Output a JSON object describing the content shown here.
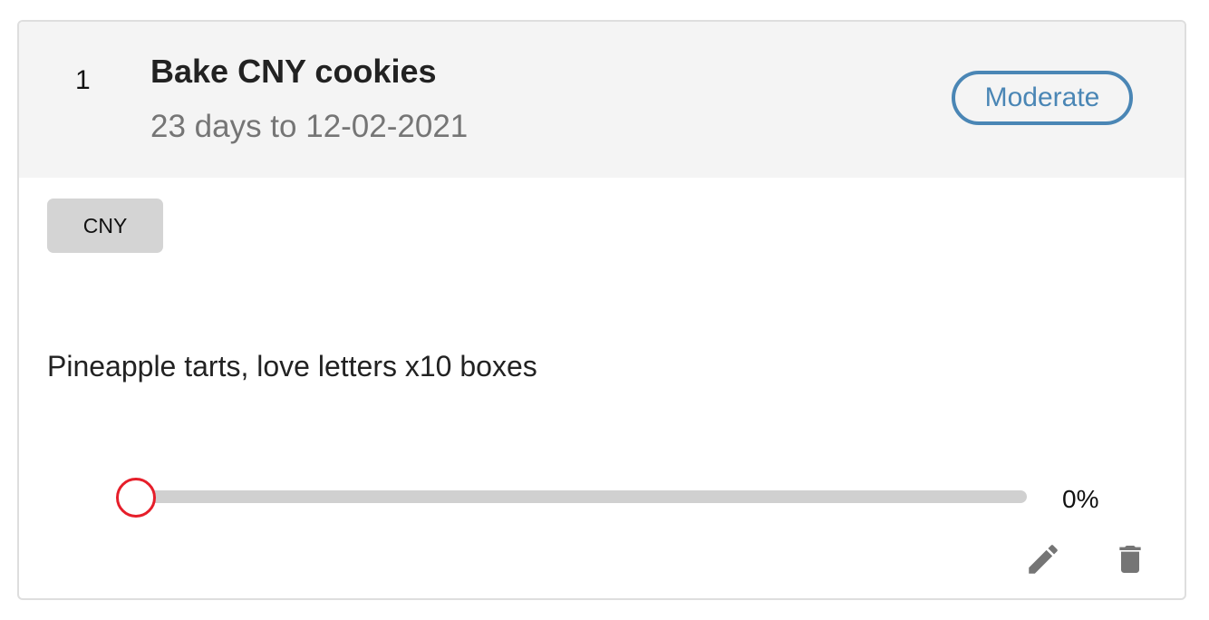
{
  "task": {
    "index": "1",
    "title": "Bake CNY cookies",
    "due_text": "23 days to 12-02-2021",
    "priority_label": "Moderate",
    "tag_label": "CNY",
    "description": "Pineapple tarts, love letters x10 boxes",
    "progress_value": 0,
    "progress_label": "0%"
  },
  "actions": {
    "edit_icon": "pencil-icon",
    "delete_icon": "trash-icon"
  },
  "colors": {
    "priority_accent": "#4a86b5",
    "slider_thumb": "#e61e2a",
    "slider_track": "#d0d0d0",
    "header_bg": "#f4f4f4",
    "tag_bg": "#d4d4d4",
    "icon_gray": "#757575"
  }
}
